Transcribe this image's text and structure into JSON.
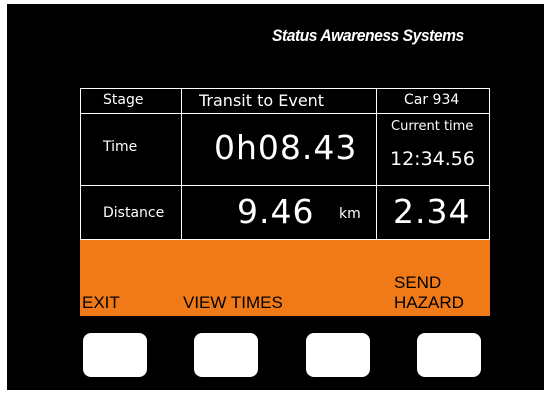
{
  "brand": "Status Awareness Systems",
  "stage": {
    "label": "Stage",
    "value": "Transit to Event",
    "car": "Car 934"
  },
  "time": {
    "label": "Time",
    "value": "0h08.43",
    "current_label": "Current time",
    "current_value": "12:34.56"
  },
  "distance": {
    "label": "Distance",
    "value": "9.46",
    "unit": "km",
    "secondary_value": "2.34"
  },
  "softkeys": {
    "exit": "EXIT",
    "view_times": "VIEW TIMES",
    "send_hazard_line1": "SEND",
    "send_hazard_line2": "HAZARD"
  },
  "colors": {
    "background": "#000000",
    "softkey_bar": "#f07a17",
    "text": "#ffffff",
    "button": "#ffffff"
  },
  "icons": [
    "hardware-button",
    "hardware-button",
    "hardware-button",
    "hardware-button"
  ]
}
